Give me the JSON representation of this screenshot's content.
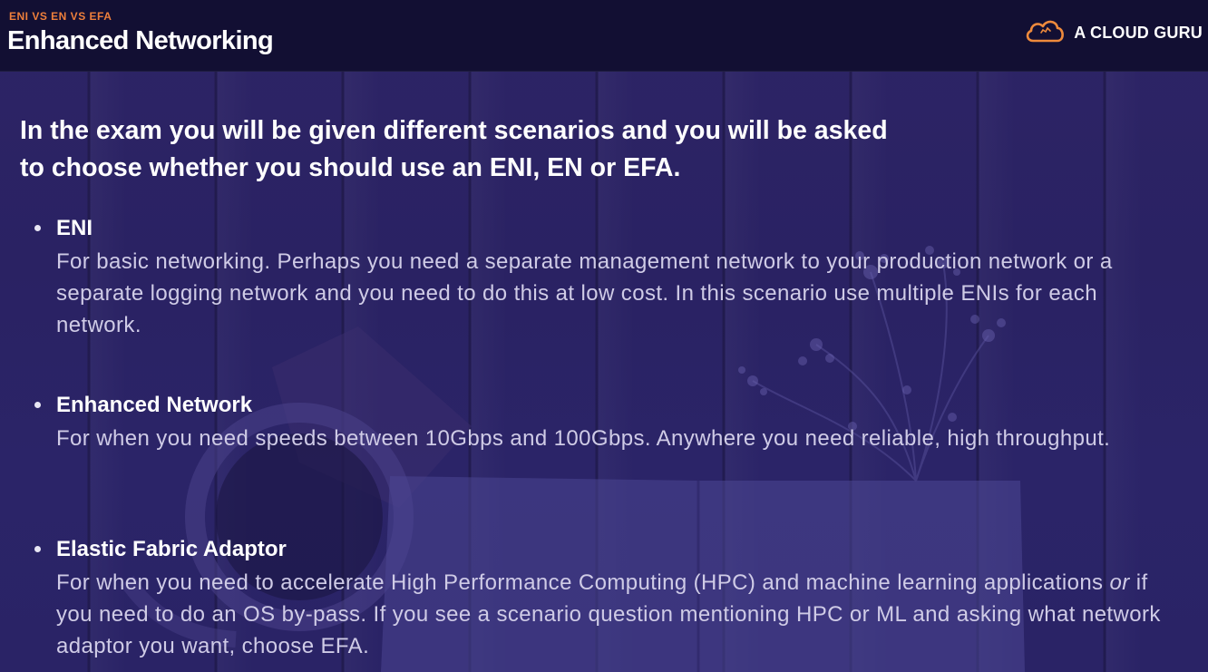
{
  "header": {
    "kicker": "ENI VS EN VS EFA",
    "title": "Enhanced Networking",
    "brand_name": "A CLOUD GURU",
    "brand_icon": "cloud-logo-icon",
    "kicker_color": "#ee7f3b"
  },
  "intro": {
    "line1": "In the exam you will be given different scenarios and you will be asked",
    "line2": "to choose whether you should use an ENI, EN or EFA."
  },
  "items": [
    {
      "title": "ENI",
      "desc": "For basic networking. Perhaps you need a separate management network to your production network or a separate logging network and you need to do this at low cost. In this scenario use multiple ENIs for each network."
    },
    {
      "title": "Enhanced Network",
      "desc": "For when you need speeds between 10Gbps and 100Gbps. Anywhere you need reliable, high throughput."
    },
    {
      "title": "Elastic Fabric Adaptor",
      "desc_before": "For when you need to accelerate High Performance Computing (HPC) and machine learning applications ",
      "desc_emphasis": "or",
      "desc_after": " if you need to do an OS by-pass. If you see a scenario question mentioning HPC or ML and asking what network adaptor you want, choose EFA."
    }
  ]
}
